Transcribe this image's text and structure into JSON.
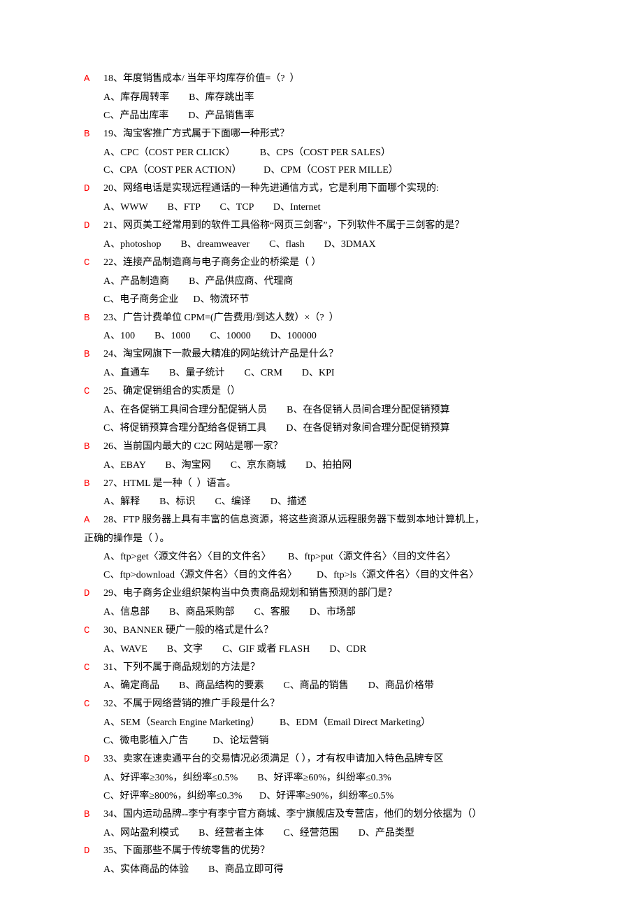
{
  "questions": [
    {
      "answer": "A",
      "q": "18、年度销售成本/ 当年平均库存价值=（?  ）",
      "opts": [
        "A、库存周转率        B、库存跳出率",
        "C、产品出库率        D、产品销售率"
      ]
    },
    {
      "answer": "B",
      "q": "19、淘宝客推广方式属于下面哪一种形式？",
      "opts": [
        "A、CPC（COST PER CLICK）          B、CPS（COST PER SALES）",
        "C、CPA（COST PER ACTION）         D、CPM（COST PER MILLE）"
      ]
    },
    {
      "answer": "D",
      "q": "20、网络电话是实现远程通话的一种先进通信方式，它是利用下面哪个实现的:",
      "opts": [
        "A、WWW        B、FTP        C、TCP        D、Internet"
      ]
    },
    {
      "answer": "D",
      "q": "21、网页美工经常用到的软件工具俗称“网页三剑客”，下列软件不属于三剑客的是？",
      "opts": [
        "A、photoshop        B、dreamweaver        C、flash        D、3DMAX"
      ]
    },
    {
      "answer": "C",
      "q": "22、连接产品制造商与电子商务企业的桥梁是（ ）",
      "opts": [
        "A、产品制造商        B、产品供应商、代理商",
        "C、电子商务企业      D、物流环节"
      ]
    },
    {
      "answer": "B",
      "q": "23、广告计费单位 CPM=(广告费用/到达人数）×（?  ）",
      "opts": [
        "A、100        B、1000        C、10000        D、100000"
      ]
    },
    {
      "answer": "B",
      "q": "24、淘宝网旗下一款最大精准的网站统计产品是什么？",
      "opts": [
        "A、直通车        B、量子统计        C、CRM        D、KPI"
      ]
    },
    {
      "answer": "C",
      "q": "25、确定促销组合的实质是（）",
      "opts": [
        "A、在各促销工具间合理分配促销人员        B、在各促销人员间合理分配促销预算",
        "C、将促销预算合理分配给各促销工具        D、在各促销对象间合理分配促销预算"
      ]
    },
    {
      "answer": "B",
      "q": "26、当前国内最大的 C2C 网站是哪一家？",
      "opts": [
        "A、EBAY        B、淘宝网        C、京东商城        D、拍拍网"
      ]
    },
    {
      "answer": "B",
      "q": "27、HTML 是一种（  ）语言。",
      "opts": [
        "A、解释        B、标识        C、编译        D、描述"
      ]
    },
    {
      "answer": "A",
      "q": "28、FTP 服务器上具有丰富的信息资源，将这些资源从远程服务器下载到本地计算机上，",
      "opts_flush": [
        "正确的操作是（ ）。"
      ],
      "opts": [
        "A、ftp>get〈源文件名〉〈目的文件名〉       B、ftp>put〈源文件名〉〈目的文件名〉",
        "C、ftp>download〈源文件名〉〈目的文件名〉        D、ftp>ls〈源文件名〉〈目的文件名〉"
      ]
    },
    {
      "answer": "D",
      "q": "29、电子商务企业组织架构当中负责商品规划和销售预测的部门是？",
      "opts": [
        "A、信息部        B、商品采购部        C、客服        D、市场部"
      ]
    },
    {
      "answer": "C",
      "q": "30、BANNER 硬广一般的格式是什么？",
      "opts": [
        "A、WAVE        B、文字        C、GIF 或者 FLASH        D、CDR"
      ]
    },
    {
      "answer": "C",
      "q": "31、下列不属于商品规划的方法是？",
      "opts": [
        "A、确定商品        B、商品结构的要素        C、商品的销售        D、商品价格带"
      ]
    },
    {
      "answer": "C",
      "q": "32、不属于网络营销的推广手段是什么？",
      "opts": [
        "A、SEM（Search Engine Marketing）        B、EDM（Email Direct Marketing）",
        "C、微电影植入广告          D、论坛营销"
      ]
    },
    {
      "answer": "D",
      "q": "33、卖家在速卖通平台的交易情况必须满足（ ），才有权申请加入特色品牌专区",
      "opts": [
        "A、好评率≥30%，纠纷率≤0.5%        B、好评率≥60%，纠纷率≤0.3%",
        "C、好评率≥800%，纠纷率≤0.3%       D、好评率≥90%，纠纷率≤0.5%"
      ]
    },
    {
      "answer": "B",
      "q": "34、国内运动品牌--李宁有李宁官方商城、李宁旗舰店及专营店，他们的划分依据为（）",
      "opts": [
        "A、网站盈利模式        B、经营者主体        C、经营范围        D、产品类型"
      ]
    },
    {
      "answer": "D",
      "q": "35、下面那些不属于传统零售的优势？",
      "opts": [
        "A、实体商品的体验        B、商品立即可得"
      ]
    }
  ]
}
